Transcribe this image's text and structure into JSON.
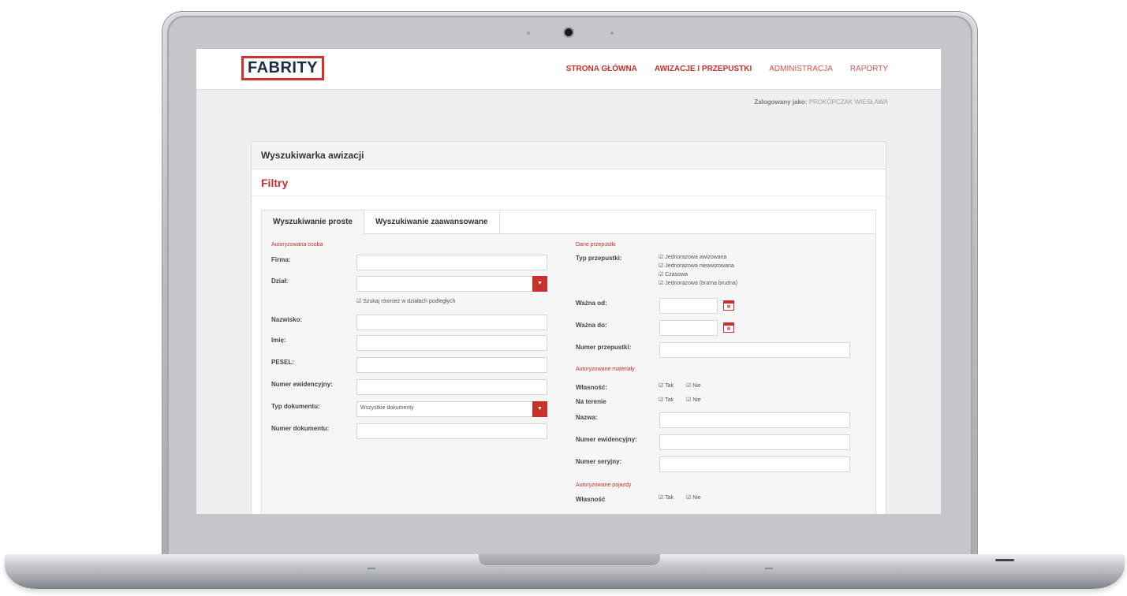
{
  "header": {
    "logo": "FABRITY",
    "nav": [
      "STRONA GŁÓWNA",
      "AWIZACJE I PRZEPUSTKI",
      "ADMINISTRACJA",
      "RAPORTY"
    ],
    "logged_label": "Zalogowany jako:",
    "logged_user": "PROKOPCZAK WIESŁAWA"
  },
  "panel": {
    "title": "Wyszukiwarka awizacji",
    "filters": "Filtry",
    "tabs": [
      "Wyszukiwanie proste",
      "Wyszukiwanie zaawansowane"
    ]
  },
  "left": {
    "section": "Autoryzowana osoba",
    "firma": "Firma:",
    "dzial": "Dział:",
    "subdepts": "Szukaj również w działach podległych",
    "nazwisko": "Nazwisko:",
    "imie": "Imię:",
    "pesel": "PESEL:",
    "nr_ewid": "Numer ewidencyjny:",
    "typ_dok": "Typ dokumentu:",
    "typ_dok_value": "Wszystkie dokumenty",
    "nr_dok": "Numer dokumentu:"
  },
  "right": {
    "section_pass": "Dane przepustki",
    "typ_przep": "Typ przepustki:",
    "pass_types": [
      "Jednorazowa awizowana",
      "Jednorazowa nieawizowana",
      "Czasowa",
      "Jednorazowa (brama brudna)"
    ],
    "wazna_od": "Ważna od:",
    "wazna_do": "Ważna do:",
    "nr_przep": "Numer przepustki:",
    "section_mat": "Autoryzowane materiały",
    "wlasnosc": "Własność:",
    "na_terenie": "Na terenie",
    "tak": "Tak",
    "nie": "Nie",
    "nazwa": "Nazwa:",
    "nr_ewid": "Numer ewidencyjny:",
    "nr_ser": "Numer seryjny:",
    "section_veh": "Autoryzowane pojazdy",
    "wlasnosc_veh": "Własność"
  },
  "icons": {
    "select": "caret-down-icon",
    "calendar": "calendar-icon",
    "check": "checkbox-checked-icon"
  },
  "colors": {
    "accent": "#c9302c",
    "navy": "#1e2a44"
  }
}
